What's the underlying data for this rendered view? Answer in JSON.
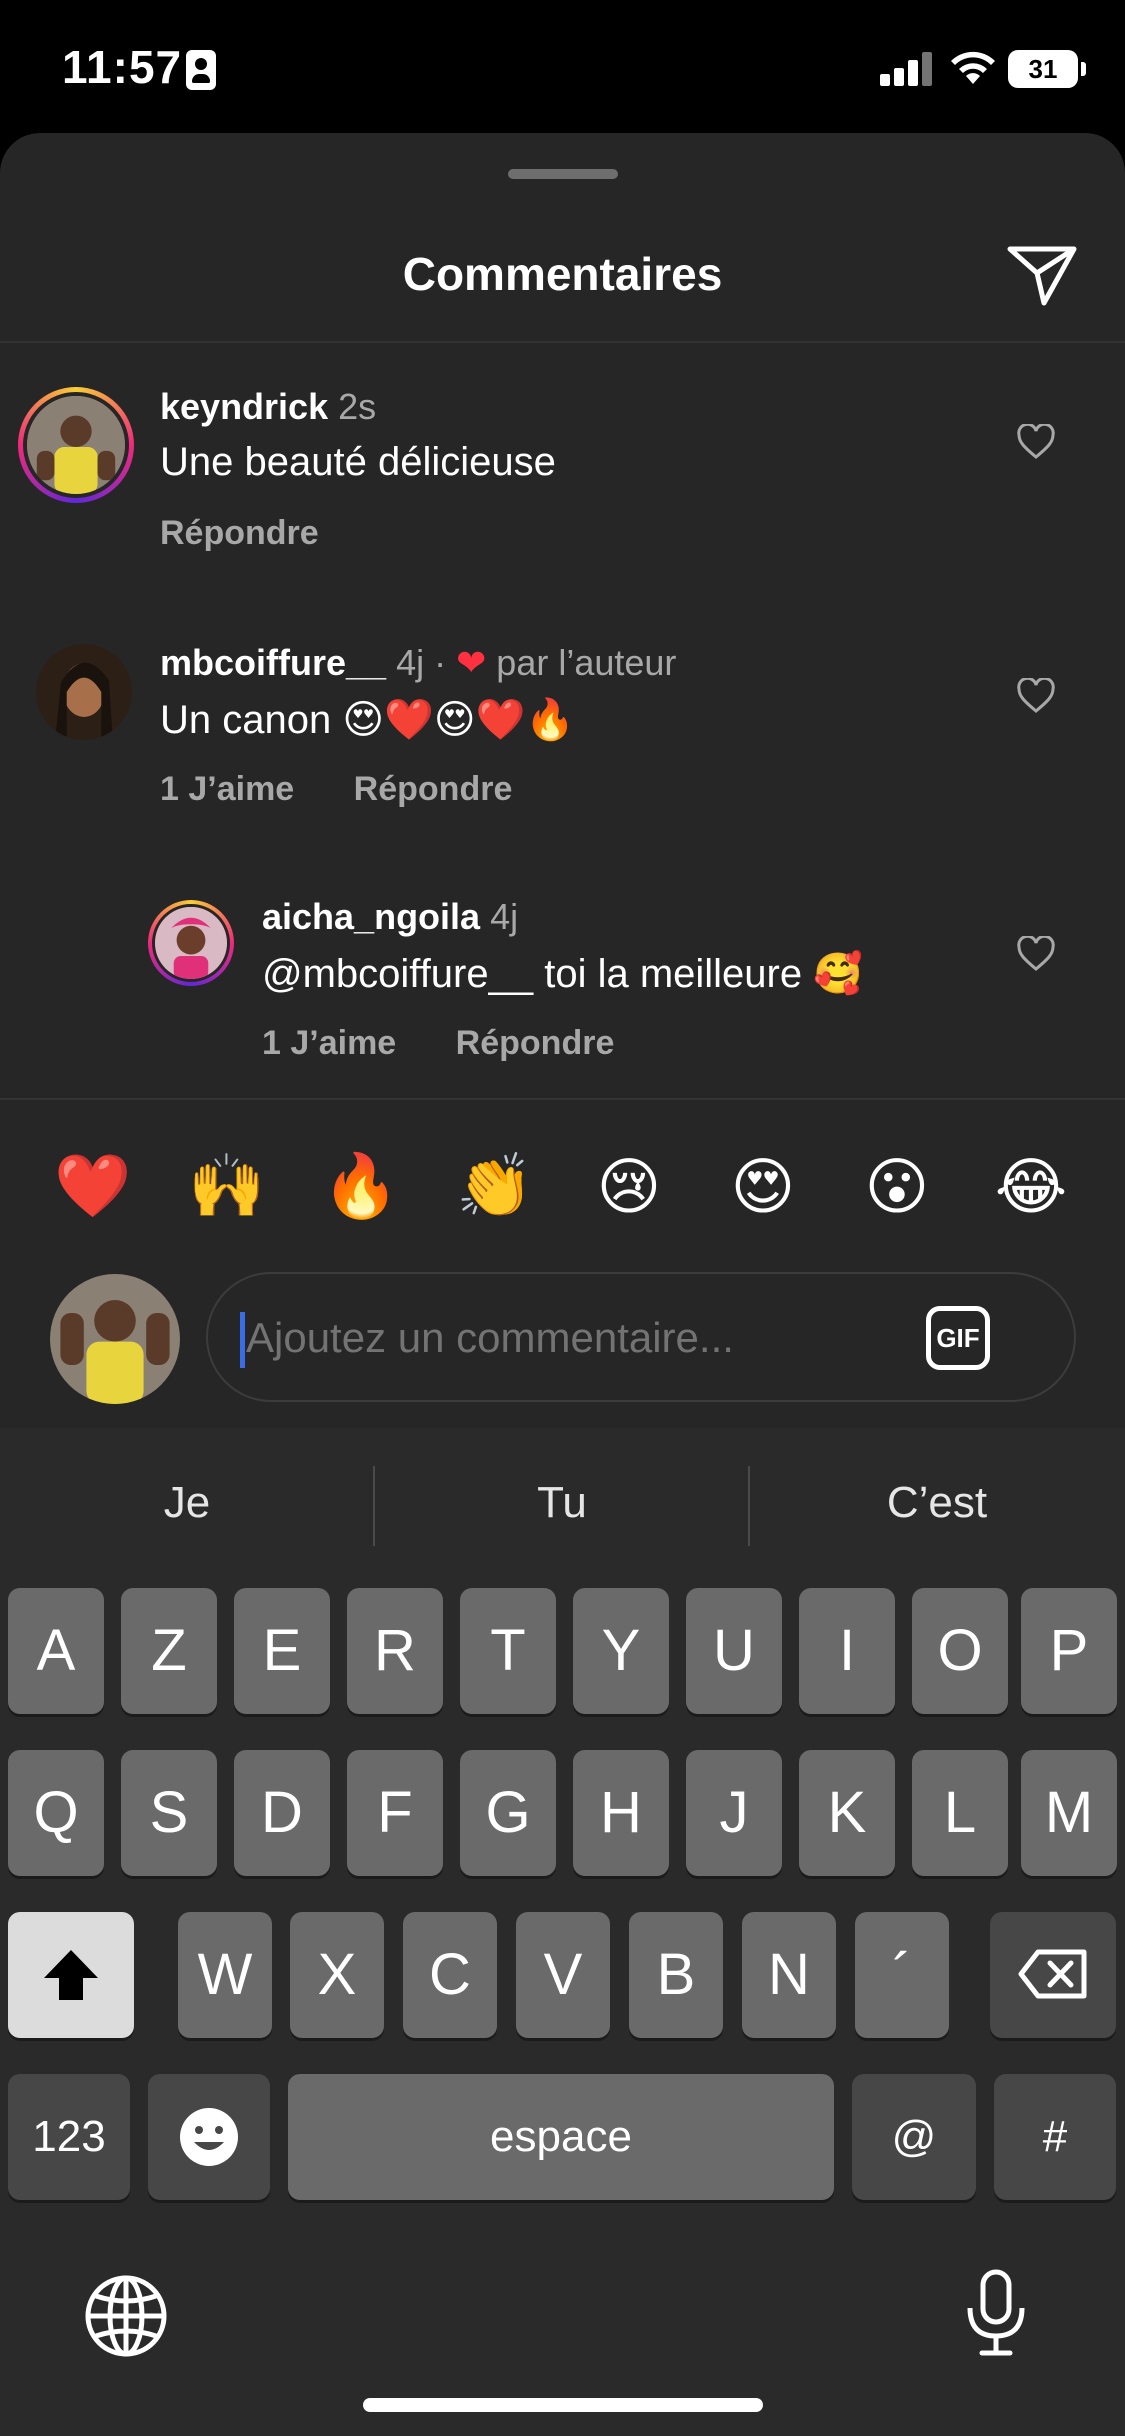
{
  "status": {
    "time": "11:57",
    "battery": "31"
  },
  "sheet": {
    "title": "Commentaires"
  },
  "comments": [
    {
      "username": "keyndrick",
      "time": "2s",
      "text": "Une beauté délicieuse",
      "reply": "Répondre"
    },
    {
      "username": "mbcoiffure__",
      "time": "4j ·",
      "liked_by_author": "par l’auteur",
      "text": "Un canon 😍❤️😍❤️🔥",
      "likes": "1 J’aime",
      "reply": "Répondre"
    },
    {
      "username": "aicha_ngoila",
      "time": "4j",
      "text": "@mbcoiffure__ toi la meilleure 🥰",
      "likes": "1 J’aime",
      "reply": "Répondre"
    }
  ],
  "emoji_bar": [
    "❤️",
    "🙌",
    "🔥",
    "👏",
    "😢",
    "😍",
    "😮",
    "😂"
  ],
  "composer": {
    "placeholder": "Ajoutez un commentaire...",
    "gif_label": "GIF"
  },
  "keyboard": {
    "suggestions": [
      "Je",
      "Tu",
      "C’est"
    ],
    "row1": [
      "A",
      "Z",
      "E",
      "R",
      "T",
      "Y",
      "U",
      "I",
      "O",
      "P"
    ],
    "row2": [
      "Q",
      "S",
      "D",
      "F",
      "G",
      "H",
      "J",
      "K",
      "L",
      "M"
    ],
    "row3": [
      "W",
      "X",
      "C",
      "V",
      "B",
      "N",
      "´"
    ],
    "numbers_label": "123",
    "space_label": "espace",
    "at_label": "@",
    "hash_label": "#"
  },
  "icons": [
    "send-icon",
    "heart-icon",
    "shift-icon",
    "backspace-icon",
    "emoji-key-icon",
    "globe-icon",
    "microphone-icon"
  ]
}
